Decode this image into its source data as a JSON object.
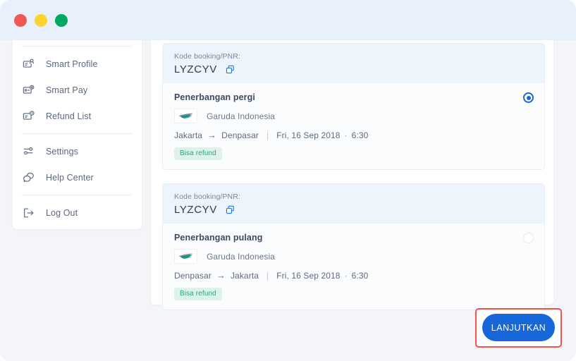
{
  "window": {
    "traffic_lights": [
      {
        "name": "close",
        "color": "#ee5a52"
      },
      {
        "name": "minimize",
        "color": "#fbd52f"
      },
      {
        "name": "maximize",
        "color": "#00a862"
      }
    ]
  },
  "sidebar": {
    "groups": [
      {
        "items": [
          {
            "icon": "smart-profile-icon",
            "label": "Smart Profile"
          },
          {
            "icon": "smart-pay-icon",
            "label": "Smart Pay"
          },
          {
            "icon": "refund-list-icon",
            "label": "Refund List"
          }
        ]
      },
      {
        "items": [
          {
            "icon": "settings-icon",
            "label": "Settings"
          },
          {
            "icon": "help-center-icon",
            "label": "Help Center"
          }
        ]
      },
      {
        "items": [
          {
            "icon": "log-out-icon",
            "label": "Log Out"
          }
        ]
      }
    ]
  },
  "main": {
    "cards": [
      {
        "pnr_label": "Kode booking/PNR:",
        "pnr_code": "LYZCYV",
        "copy_icon": "copy-icon",
        "flight_title": "Penerbangan pergi",
        "airline": "Garuda Indonesia",
        "airline_logo": "garuda-indonesia-logo",
        "origin": "Jakarta",
        "arrow": "→",
        "destination": "Denpasar",
        "divider": "|",
        "date": "Fri, 16 Sep 2018",
        "dot": "·",
        "time": "6:30",
        "badge": "Bisa refund",
        "selected": true
      },
      {
        "pnr_label": "Kode booking/PNR:",
        "pnr_code": "LYZCYV",
        "copy_icon": "copy-icon",
        "flight_title": "Penerbangan pulang",
        "airline": "Garuda Indonesia",
        "airline_logo": "garuda-indonesia-logo",
        "origin": "Denpasar",
        "arrow": "→",
        "destination": "Jakarta",
        "divider": "|",
        "date": "Fri, 16 Sep 2018",
        "dot": "·",
        "time": "6:30",
        "badge": "Bisa refund",
        "selected": false
      }
    ]
  },
  "cta": {
    "label": "LANJUTKAN",
    "color": "#1667d8",
    "highlight_color": "#f0544a"
  }
}
